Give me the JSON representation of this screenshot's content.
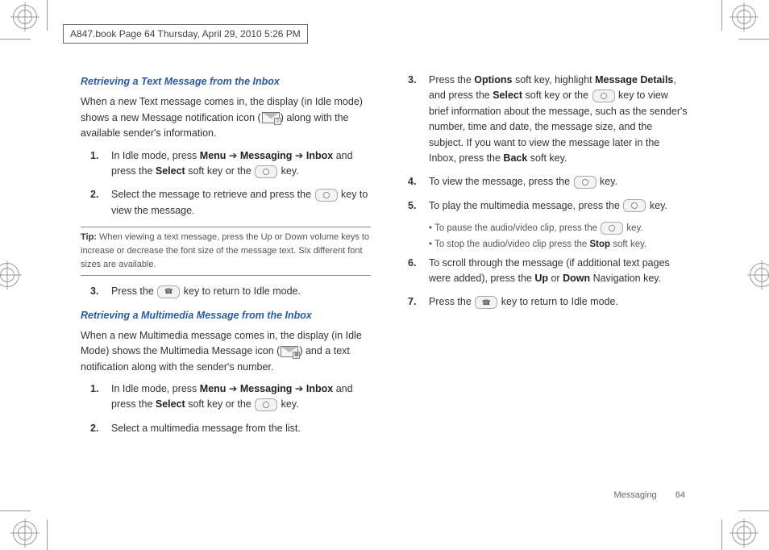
{
  "header": {
    "text": "A847.book  Page 64  Thursday, April 29, 2010  5:26 PM"
  },
  "footer": {
    "section": "Messaging",
    "page": "64"
  },
  "left": {
    "title1": "Retrieving a Text Message from the Inbox",
    "intro1a": "When a new Text message comes in, the display (in Idle mode) shows a new Message notification icon (",
    "intro1b": ") along with the available sender's information.",
    "list1": {
      "n1": "1.",
      "t1a": "In Idle mode, press ",
      "t1b": "Menu",
      "t1c": " ➔ ",
      "t1d": "Messaging",
      "t1e": " ➔ ",
      "t1f": "Inbox",
      "t1g": " and press the ",
      "t1h": "Select",
      "t1i": " soft key or the ",
      "t1j": " key.",
      "n2": "2.",
      "t2a": "Select the message to retrieve and press the ",
      "t2b": " key to view the message."
    },
    "tiplabel": "Tip:",
    "tiptext": " When viewing a text message, press the Up or Down volume keys to increase or decrease the font size of the message text. Six different font sizes are available.",
    "list1b": {
      "n3": "3.",
      "t3a": "Press the ",
      "t3b": " key to return to Idle mode."
    },
    "title2": "Retrieving a Multimedia Message from the Inbox",
    "intro2a": "When a new Multimedia message comes in, the display (in Idle Mode) shows the Multimedia Message icon (",
    "intro2b": ") and a text notification along with the sender's number.",
    "list2": {
      "n1": "1.",
      "t1a": "In Idle mode, press ",
      "t1b": "Menu",
      "t1c": " ➔ ",
      "t1d": "Messaging",
      "t1e": " ➔ ",
      "t1f": "Inbox",
      "t1g": " and press the ",
      "t1h": "Select",
      "t1i": " soft key or the ",
      "t1j": " key.",
      "n2": "2.",
      "t2": "Select a multimedia message from the list."
    }
  },
  "right": {
    "list": {
      "n3": "3.",
      "t3a": "Press the ",
      "t3b": "Options",
      "t3c": " soft key, highlight ",
      "t3d": "Message Details",
      "t3e": ", and press the ",
      "t3f": "Select",
      "t3g": " soft key or the ",
      "t3h": " key to view brief information about the message, such as the sender's number, time and date, the message size, and the subject. If you want to view the message later in the Inbox, press the ",
      "t3i": "Back",
      "t3j": " soft key.",
      "n4": "4.",
      "t4a": "To view the message, press the ",
      "t4b": " key.",
      "n5": "5.",
      "t5a": "To play the multimedia message, press the ",
      "t5b": " key.",
      "b1a": "To pause the audio/video clip, press the ",
      "b1b": " key.",
      "b2a": "To stop the audio/video clip press the ",
      "b2b": "Stop",
      "b2c": " soft key.",
      "n6": "6.",
      "t6a": "To scroll through the message (if additional text pages were added), press the ",
      "t6b": "Up",
      "t6c": " or ",
      "t6d": "Down",
      "t6e": " Navigation key.",
      "n7": "7.",
      "t7a": "Press the ",
      "t7b": " key to return to Idle mode."
    }
  }
}
